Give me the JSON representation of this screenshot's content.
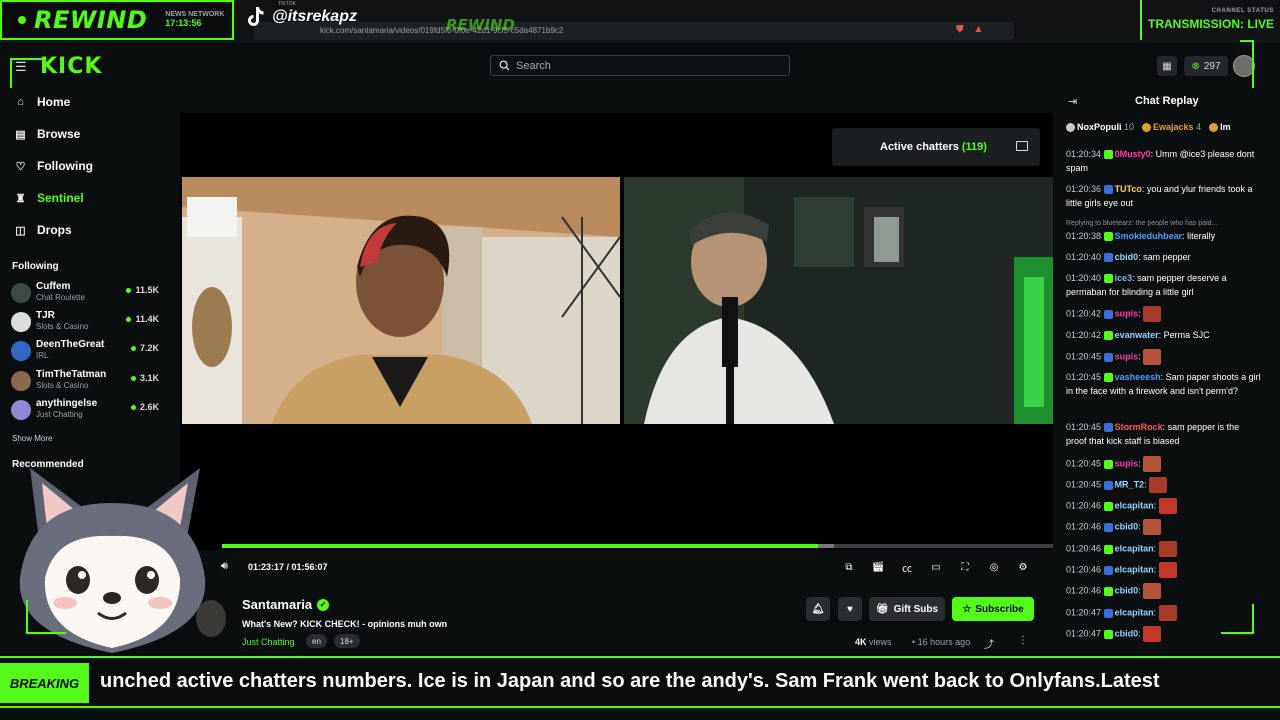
{
  "overlay": {
    "brand": "REWIND",
    "network_label": "NEWS NETWORK",
    "clock": "17:13:56",
    "tiktok_label": "TIKTOK",
    "tiktok_handle": "@itsrekapz",
    "ghost_brand": "REWIND",
    "browser_url": "kick.com/santamaria/videos/019fd5f0-0f0e-42d1-9cf5-c5da4871b9c2",
    "channel_status_label": "CHANNEL STATUS",
    "channel_status": "TRANSMISSION: LIVE"
  },
  "header": {
    "search_placeholder": "Search",
    "kicks_count": "297"
  },
  "sidebar": {
    "nav": [
      {
        "label": "Home",
        "icon": "home-icon"
      },
      {
        "label": "Browse",
        "icon": "browse-icon"
      },
      {
        "label": "Following",
        "icon": "heart-icon"
      },
      {
        "label": "Sentinel",
        "icon": "sentinel-icon",
        "active": true
      },
      {
        "label": "Drops",
        "icon": "drops-icon"
      }
    ],
    "following_title": "Following",
    "following": [
      {
        "name": "Cuffem",
        "category": "Chat Roulette",
        "viewers": "11.5K",
        "color": "#3b4a44"
      },
      {
        "name": "TJR",
        "category": "Slots & Casino",
        "viewers": "11.4K",
        "color": "#ddd"
      },
      {
        "name": "DeenTheGreat",
        "category": "IRL",
        "viewers": "7.2K",
        "color": "#3068c4"
      },
      {
        "name": "TimTheTatman",
        "category": "Slots & Casino",
        "viewers": "3.1K",
        "color": "#8a6b4b"
      },
      {
        "name": "anythingelse",
        "category": "Just Chatting",
        "viewers": "2.6K",
        "color": "#8f8ad6"
      }
    ],
    "show_more": "Show More",
    "recommended_title": "Recommended"
  },
  "player": {
    "active_chatters_label": "Active chatters",
    "active_chatters_count": "(119)",
    "time": "01:23:17 / 01:56:07",
    "progress_fraction": 0.717
  },
  "stream": {
    "streamer": "Santamaria",
    "title": "What's New? KICK CHECK! - opinions muh own",
    "category": "Just Chatting",
    "tags": [
      "en",
      "18+"
    ],
    "gift_subs_label": "Gift Subs",
    "subscribe_label": "Subscribe",
    "views_count": "4K",
    "views_label": "views",
    "age": "16 hours ago"
  },
  "chat": {
    "title": "Chat Replay",
    "top_gifters": [
      {
        "name": "NoxPopuli",
        "count": "10",
        "color": "#c9c9c9"
      },
      {
        "name": "Ewajacks",
        "count": "4",
        "color": "#e0a030"
      },
      {
        "name": "Im",
        "count": "",
        "color": "#e0a030"
      }
    ],
    "reply_note": "Replying to bluetearz: the people who has paid...",
    "messages": [
      {
        "ts": "01:20:34",
        "user": "0Musty0",
        "color": "#ff3da6",
        "text": "Umm @ice3 please dont spam"
      },
      {
        "ts": "01:20:36",
        "user": "TUTco",
        "color": "#ffd24a",
        "text": "you and ylur friends took a little girls eye out"
      },
      {
        "ts": "01:20:38",
        "user": "Smokieduhbear",
        "color": "#3fa0ff",
        "text": "literally"
      },
      {
        "ts": "01:20:40",
        "user": "cbid0",
        "color": "#8fd6ff",
        "text": "sam pepper"
      },
      {
        "ts": "01:20:40",
        "user": "ice3",
        "color": "#7fb4ff",
        "text": "sam pepper deserve a permaban for blinding a little girl"
      },
      {
        "ts": "01:20:42",
        "user": "supis",
        "color": "#ff3da6",
        "text": ""
      },
      {
        "ts": "01:20:42",
        "user": "evanwater",
        "color": "#8fd6ff",
        "text": "Perma SJC"
      },
      {
        "ts": "01:20:45",
        "user": "supis",
        "color": "#ff3da6",
        "text": ""
      },
      {
        "ts": "01:20:45",
        "user": "vasheeesh",
        "color": "#3fa0ff",
        "text": "Sam paper shoots a girl in the face with a firework and isn't perm'd?"
      },
      {
        "ts": "01:20:45",
        "user": "StormRock",
        "color": "#ff5a5a",
        "text": "sam pepper is the proof that kick staff is biased"
      },
      {
        "ts": "01:20:45",
        "user": "supis",
        "color": "#ff3da6",
        "text": ""
      },
      {
        "ts": "01:20:45",
        "user": "MR_T2",
        "color": "#8fd6ff",
        "text": ""
      },
      {
        "ts": "01:20:46",
        "user": "elcapitan",
        "color": "#8fd6ff",
        "text": ""
      },
      {
        "ts": "01:20:46",
        "user": "cbid0",
        "color": "#8fd6ff",
        "text": ""
      },
      {
        "ts": "01:20:46",
        "user": "elcapitan",
        "color": "#8fd6ff",
        "text": ""
      },
      {
        "ts": "01:20:46",
        "user": "elcapitan",
        "color": "#8fd6ff",
        "text": ""
      },
      {
        "ts": "01:20:46",
        "user": "cbid0",
        "color": "#8fd6ff",
        "text": ""
      },
      {
        "ts": "01:20:47",
        "user": "elcapitan",
        "color": "#8fd6ff",
        "text": ""
      },
      {
        "ts": "01:20:47",
        "user": "cbid0",
        "color": "#8fd6ff",
        "text": ""
      }
    ]
  },
  "ticker": {
    "label": "BREAKING",
    "text": "unched active chatters numbers. Ice is in Japan and so are the andy's. Sam Frank went back to Onlyfans.Latest"
  },
  "colors": {
    "accent": "#53fc18",
    "background": "#0b0e0f"
  }
}
